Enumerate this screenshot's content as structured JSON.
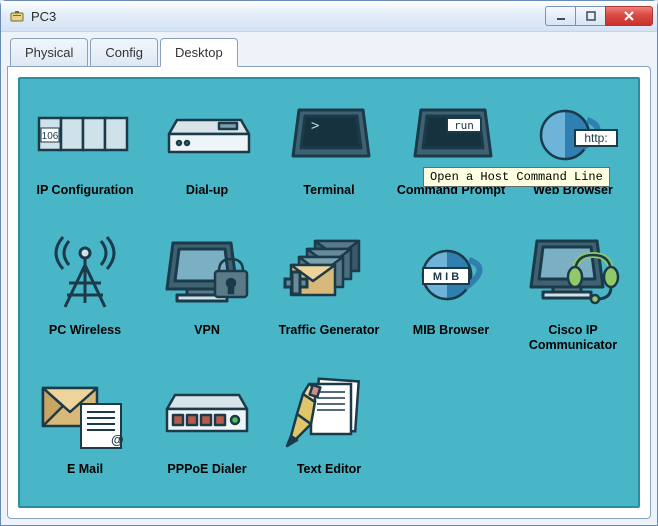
{
  "window": {
    "title": "PC3"
  },
  "tabs": {
    "physical": "Physical",
    "config": "Config",
    "desktop": "Desktop"
  },
  "tooltip": "Open a Host Command Line",
  "apps": {
    "ip_config": "IP Configuration",
    "dialup": "Dial-up",
    "terminal": "Terminal",
    "cmd": "Command Prompt",
    "browser": "Web Browser",
    "wireless": "PC Wireless",
    "vpn": "VPN",
    "traffic": "Traffic Generator",
    "mib": "MIB Browser",
    "ipcomm": "Cisco IP Communicator",
    "email": "E Mail",
    "pppoe": "PPPoE Dialer",
    "texteditor": "Text Editor"
  },
  "icon_text": {
    "ip_num": "106",
    "cmd_run": "run",
    "http": "http:",
    "mib": "M I B",
    "email_at": "@",
    "terminal_prompt": ">"
  },
  "colors": {
    "desk_bg": "#49b6c7",
    "desk_border": "#2b8d9d",
    "close_btn": "#c9302c"
  }
}
